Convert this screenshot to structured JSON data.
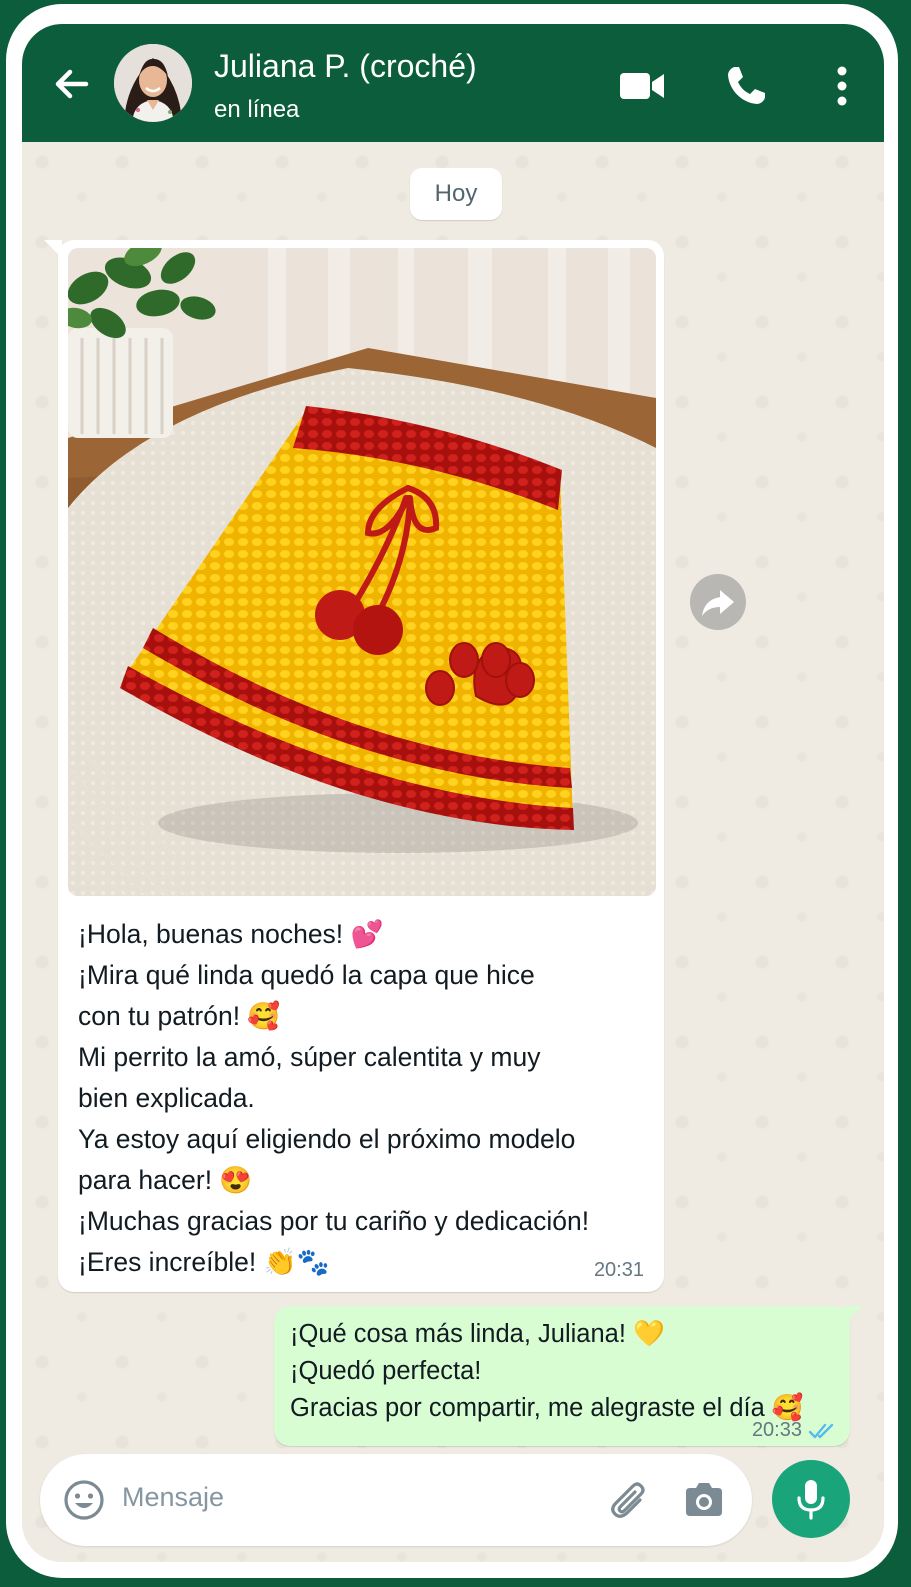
{
  "header": {
    "contact_name": "Juliana P. (croché)",
    "status": "en línea",
    "icons": [
      "back-arrow-icon",
      "video-call-icon",
      "phone-icon",
      "more-vertical-icon"
    ],
    "color": "#0b5d3b"
  },
  "chat": {
    "date_chip": "Hoy",
    "incoming": {
      "image_description_icon": "photo-crochet-dog-cape",
      "lines": [
        "¡Hola,  buenas noches! 💕",
        "¡Mira qué linda quedó la capa que hice",
        "con tu patrón! 🥰",
        "Mi perrito la amó, súper calentita y muy",
        "bien explicada.",
        "Ya estoy aquí eligiendo el próximo modelo",
        "para hacer! 😍",
        "¡Muchas gracias por tu cariño y dedicación!",
        "¡Eres increíble! 👏🐾"
      ],
      "time": "20:31"
    },
    "outgoing": {
      "lines": [
        "¡Qué cosa más linda, Juliana! 💛",
        "¡Quedó perfecta!",
        "Gracias por compartir, me alegraste el día 🥰"
      ],
      "time": "20:33",
      "status_icon": "double-check-read-icon"
    }
  },
  "composer": {
    "placeholder": "Mensaje",
    "icons": [
      "emoji-icon",
      "attach-icon",
      "camera-icon",
      "mic-icon"
    ],
    "send_color": "#1aa47a"
  }
}
